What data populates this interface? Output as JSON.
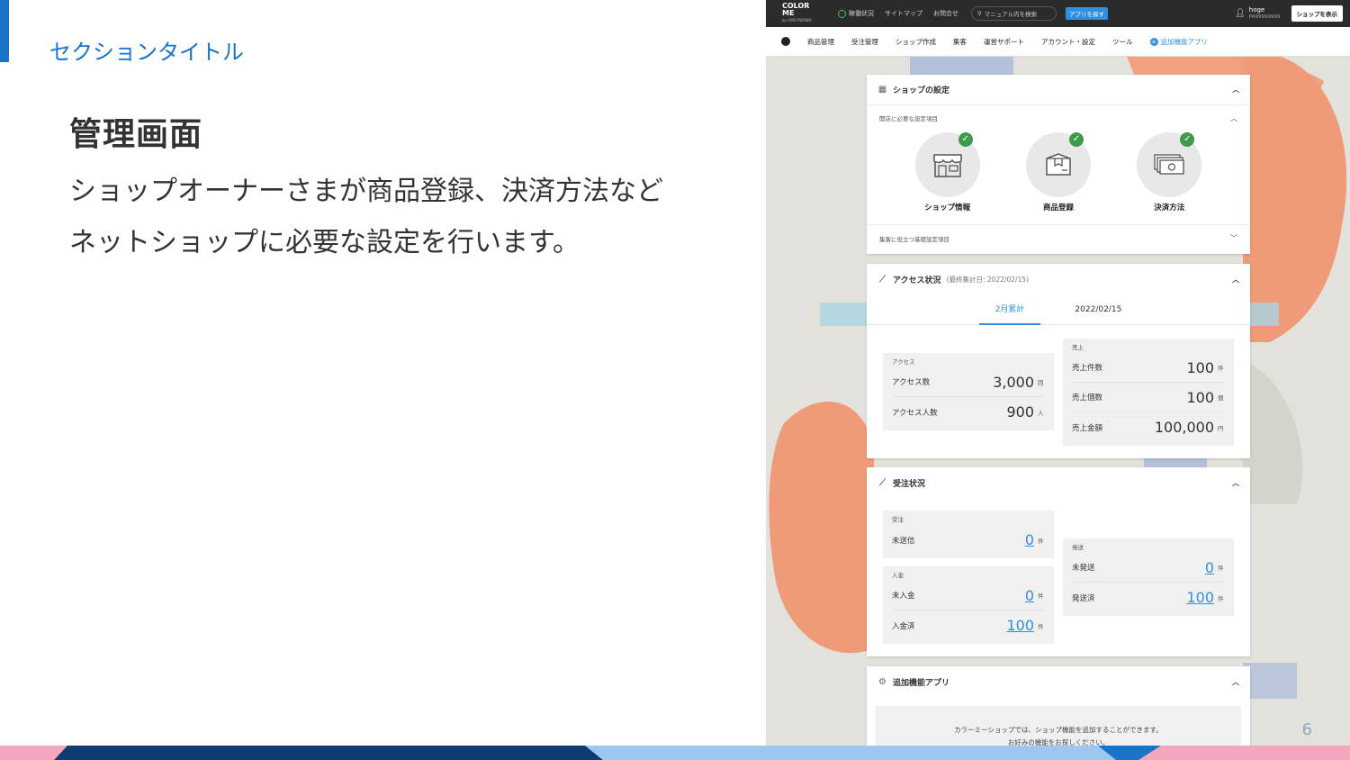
{
  "slide": {
    "section_title": "セクションタイトル",
    "heading": "管理画面",
    "body_line1": "ショップオーナーさまが商品登録、決済方法など",
    "body_line2": "ネットショップに必要な設定を行います。",
    "page_number": "6",
    "accent_color": "#1a73c8"
  },
  "topbar": {
    "logo": "COLOR ME",
    "logo_sub": "by GMO PEPABO",
    "status": "稼働状況",
    "sitemap": "サイトマップ",
    "contact": "お問合せ",
    "search_placeholder": "マニュアル内を検索",
    "find_app": "アプリを探す",
    "user_name": "hoge",
    "user_id": "PA99999999",
    "show_shop": "ショップを表示"
  },
  "nav": {
    "items": [
      "商品管理",
      "受注管理",
      "ショップ作成",
      "集客",
      "運営サポート",
      "アカウント・設定",
      "ツール"
    ],
    "addon": "追加機能アプリ"
  },
  "shop_settings": {
    "title": "ショップの設定",
    "required_label": "開店に必要な設定項目",
    "items": [
      {
        "label": "ショップ情報",
        "icon": "storefront-icon"
      },
      {
        "label": "商品登録",
        "icon": "box-icon"
      },
      {
        "label": "決済方法",
        "icon": "cash-icon"
      }
    ],
    "basic_label": "集客に役立つ基礎設定項目"
  },
  "access": {
    "title": "アクセス状況",
    "subtitle": "(最終集計日: 2022/02/15)",
    "tabs": [
      "2月累計",
      "2022/02/15"
    ],
    "access_cat": "アクセス",
    "access_rows": [
      {
        "label": "アクセス数",
        "value": "3,000",
        "unit": "回"
      },
      {
        "label": "アクセス人数",
        "value": "900",
        "unit": "人"
      }
    ],
    "sales_cat": "売上",
    "sales_rows": [
      {
        "label": "売上件数",
        "value": "100",
        "unit": "件"
      },
      {
        "label": "売上個数",
        "value": "100",
        "unit": "個"
      },
      {
        "label": "売上金額",
        "value": "100,000",
        "unit": "円"
      }
    ]
  },
  "orders": {
    "title": "受注状況",
    "order_cat": "受注",
    "order_rows": [
      {
        "label": "未送信",
        "value": "0",
        "unit": "件"
      }
    ],
    "payment_cat": "入金",
    "payment_rows": [
      {
        "label": "未入金",
        "value": "0",
        "unit": "件"
      },
      {
        "label": "入金済",
        "value": "100",
        "unit": "件"
      }
    ],
    "ship_cat": "発送",
    "ship_rows": [
      {
        "label": "未発送",
        "value": "0",
        "unit": "件"
      },
      {
        "label": "発送済",
        "value": "100",
        "unit": "件"
      }
    ]
  },
  "addon_card": {
    "title": "追加機能アプリ",
    "line1": "カラーミーショップでは、ショップ機能を追加することができます。",
    "line2": "お好みの機能をお探しください。"
  }
}
